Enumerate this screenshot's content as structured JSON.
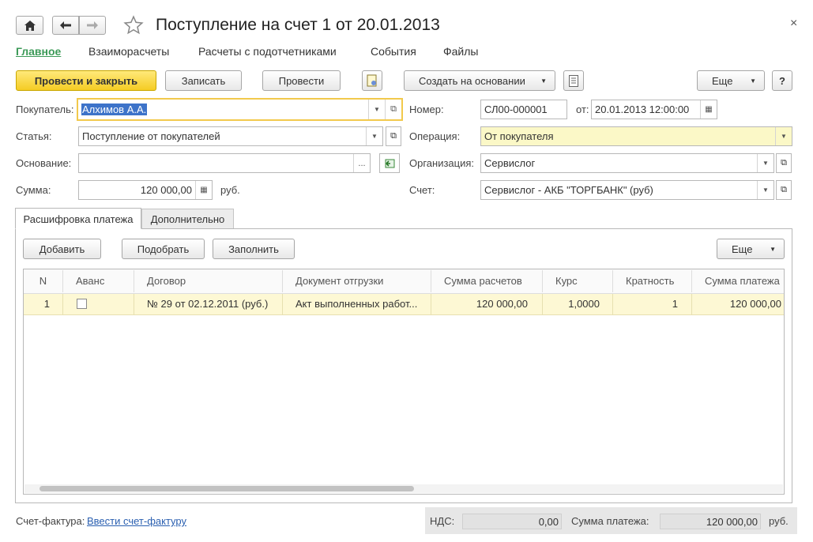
{
  "title": "Поступление на счет 1 от 20.01.2013",
  "nav_tabs": [
    "Главное",
    "Взаиморасчеты",
    "Расчеты с подотчетниками",
    "События",
    "Файлы"
  ],
  "toolbar": {
    "post_close": "Провести и закрыть",
    "save": "Записать",
    "post": "Провести",
    "create_based": "Создать на основании",
    "more": "Еще",
    "help": "?"
  },
  "form": {
    "buyer_label": "Покупатель:",
    "buyer_value": "Алхимов А.А.",
    "article_label": "Статья:",
    "article_value": "Поступление от покупателей",
    "basis_label": "Основание:",
    "basis_value": "",
    "amount_label": "Сумма:",
    "amount_value": "120 000,00",
    "currency": "руб.",
    "number_label": "Номер:",
    "number_value": "СЛ00-000001",
    "from_label": "от:",
    "date_value": "20.01.2013 12:00:00",
    "operation_label": "Операция:",
    "operation_value": "От покупателя",
    "org_label": "Организация:",
    "org_value": "Сервислог",
    "account_label": "Счет:",
    "account_value": "Сервислог - АКБ \"ТОРГБАНК\" (руб)"
  },
  "tabs": [
    "Расшифровка платежа",
    "Дополнительно"
  ],
  "table_toolbar": {
    "add": "Добавить",
    "pick": "Подобрать",
    "fill": "Заполнить",
    "more": "Еще"
  },
  "table": {
    "headers": [
      "N",
      "Аванс",
      "Договор",
      "Документ отгрузки",
      "Сумма расчетов",
      "Курс",
      "Кратность",
      "Сумма платежа"
    ],
    "rows": [
      {
        "n": "1",
        "advance": false,
        "contract": "№ 29 от 02.12.2011 (руб.)",
        "doc": "Акт выполненных работ...",
        "sum": "120 000,00",
        "rate": "1,0000",
        "mult": "1",
        "payment": "120 000,00"
      }
    ]
  },
  "footer": {
    "invoice_label": "Счет-фактура:",
    "invoice_link": "Ввести счет-фактуру",
    "vat_label": "НДС:",
    "vat_value": "0,00",
    "payment_label": "Сумма платежа:",
    "payment_value": "120 000,00",
    "currency": "руб."
  },
  "colors": {
    "accent_green": "#3c9a58",
    "primary_button": "#f5cc24",
    "row_highlight": "#fdf8d4",
    "link": "#2a5fb0"
  }
}
